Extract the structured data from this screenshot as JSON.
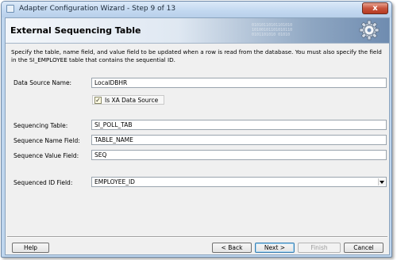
{
  "window": {
    "title": "Adapter Configuration Wizard - Step 9 of 13",
    "close_glyph": "x"
  },
  "header": {
    "title": "External Sequencing Table",
    "decor_bits": "01010110101101010\n10100101101010110\n0101101010 01010"
  },
  "instructions": "Specify the table, name field, and value field to be updated when a row is read from the database. You must also specify the field in the SI_EMPLOYEE table that contains the sequential ID.",
  "form": {
    "data_source": {
      "label": "Data Source Name:",
      "value": "LocalDBHR"
    },
    "xa_checkbox": {
      "label": "Is XA Data Source",
      "checked": true,
      "check_glyph": "✓"
    },
    "sequencing_table": {
      "label": "Sequencing Table:",
      "value": "SI_POLL_TAB"
    },
    "sequence_name_field": {
      "label": "Sequence Name Field:",
      "value": "TABLE_NAME"
    },
    "sequence_value_field": {
      "label": "Sequence Value Field:",
      "value": "SEQ"
    },
    "sequenced_id_field": {
      "label": "Sequenced ID Field:",
      "value": "EMPLOYEE_ID"
    }
  },
  "buttons": {
    "help": "Help",
    "back": "< Back",
    "next": "Next >",
    "finish": "Finish",
    "cancel": "Cancel"
  },
  "icons": {
    "title": "window-app-icon",
    "header": "gear-icon",
    "dropdown": "chevron-down-icon"
  },
  "colors": {
    "frame": "#bfd6ee",
    "close_button": "#c8533c",
    "header_gradient_end": "#6f8cb0",
    "dialog_background": "#f0f0f0"
  }
}
